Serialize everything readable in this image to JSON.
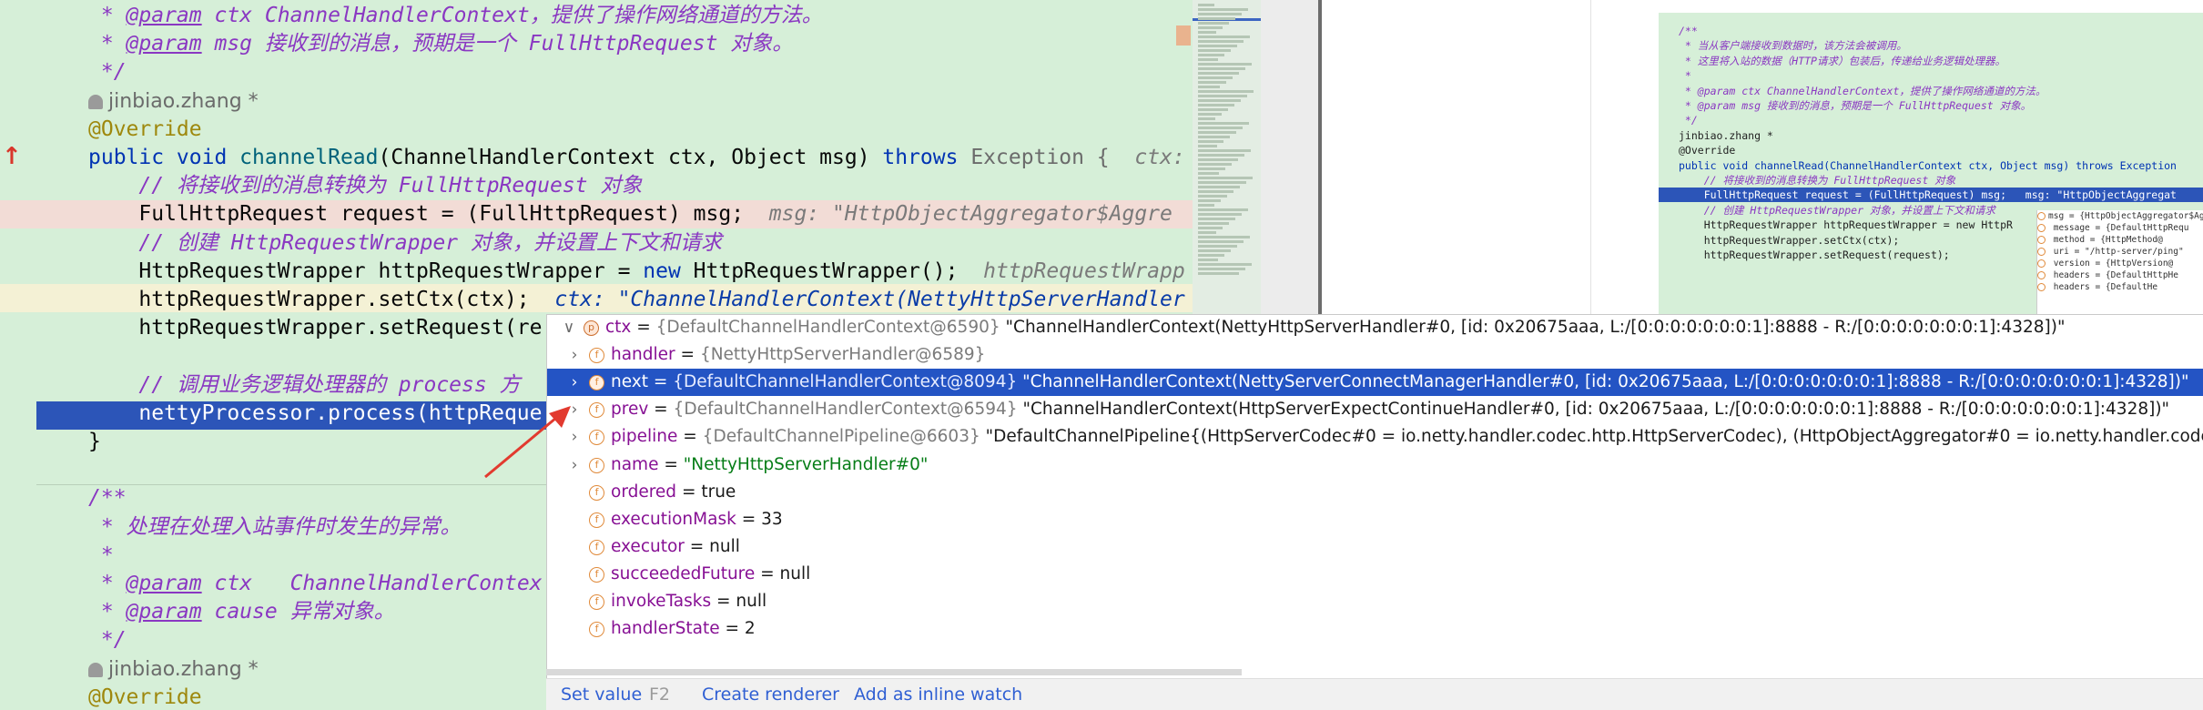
{
  "editor": {
    "lines": [
      {
        "segments": [
          {
            "t": " * ",
            "c": "c-cmt"
          },
          {
            "t": "@param",
            "c": "c-tag"
          },
          {
            "t": " ctx ",
            "c": "c-cmt"
          },
          {
            "t": "ChannelHandlerContext，提供了操作网络通道的方法。",
            "c": "c-cmt"
          }
        ]
      },
      {
        "segments": [
          {
            "t": " * ",
            "c": "c-cmt"
          },
          {
            "t": "@param",
            "c": "c-tag"
          },
          {
            "t": " msg 接收到的消息，预期是一个 FullHttpRequest 对象。",
            "c": "c-cmt"
          }
        ]
      },
      {
        "segments": [
          {
            "t": " */",
            "c": "c-cmt"
          }
        ]
      },
      {
        "author": "jinbiao.zhang *"
      },
      {
        "segments": [
          {
            "t": "@Override",
            "c": "c-ann"
          }
        ]
      },
      {
        "segments": [
          {
            "t": "public void ",
            "c": "c-kw"
          },
          {
            "t": "channelRead",
            "c": "c-fn"
          },
          {
            "t": "(ChannelHandlerContext ctx, Object msg) ",
            "c": ""
          },
          {
            "t": "throws ",
            "c": "c-kw"
          },
          {
            "t": "Exception {",
            "c": "c-grey"
          },
          {
            "t": "  ctx: ",
            "c": "c-inl"
          }
        ]
      },
      {
        "segments": [
          {
            "t": "    // 将接收到的消息转换为 FullHttpRequest 对象",
            "c": "c-cmt"
          }
        ]
      },
      {
        "segments": [
          {
            "t": "    FullHttpRequest request = (FullHttpRequest) msg;",
            "c": ""
          },
          {
            "t": "  msg: \"HttpObjectAggregator$Aggre",
            "c": "c-inl"
          }
        ]
      },
      {
        "segments": [
          {
            "t": "    // 创建 HttpRequestWrapper 对象，并设置上下文和请求",
            "c": "c-cmt"
          }
        ]
      },
      {
        "segments": [
          {
            "t": "    HttpRequestWrapper httpRequestWrapper = ",
            "c": ""
          },
          {
            "t": "new ",
            "c": "c-kw"
          },
          {
            "t": "HttpRequestWrapper();",
            "c": ""
          },
          {
            "t": "  httpRequestWrapp",
            "c": "c-inl"
          }
        ]
      },
      {
        "segments": [
          {
            "t": "    httpRequestWrapper.setCtx(ctx);",
            "c": ""
          },
          {
            "t": "  ctx: \"ChannelHandlerContext(NettyHttpServerHandler",
            "c": "c-inl-b"
          }
        ]
      },
      {
        "segments": [
          {
            "t": "    httpRequestWrapper.setRequest(re",
            "c": ""
          }
        ]
      },
      {
        "segments": [
          {
            "t": "",
            "c": ""
          }
        ]
      },
      {
        "segments": [
          {
            "t": "    // 调用业务逻辑处理器的 process 方",
            "c": "c-cmt"
          }
        ]
      },
      {
        "segments": [
          {
            "t": "    nettyProcessor.process(httpReque",
            "c": "c-white"
          }
        ]
      },
      {
        "segments": [
          {
            "t": "}",
            "c": ""
          }
        ]
      },
      {
        "segments": [
          {
            "t": "",
            "c": ""
          }
        ]
      },
      {
        "segments": [
          {
            "t": "/**",
            "c": "c-cmt"
          }
        ]
      },
      {
        "segments": [
          {
            "t": " * 处理在处理入站事件时发生的异常。",
            "c": "c-cmt"
          }
        ]
      },
      {
        "segments": [
          {
            "t": " *",
            "c": "c-cmt"
          }
        ]
      },
      {
        "segments": [
          {
            "t": " * ",
            "c": "c-cmt"
          },
          {
            "t": "@param",
            "c": "c-tag"
          },
          {
            "t": " ctx   ChannelHandlerContex",
            "c": "c-cmt"
          }
        ]
      },
      {
        "segments": [
          {
            "t": " * ",
            "c": "c-cmt"
          },
          {
            "t": "@param",
            "c": "c-tag"
          },
          {
            "t": " cause 异常对象。",
            "c": "c-cmt"
          }
        ]
      },
      {
        "segments": [
          {
            "t": " */",
            "c": "c-cmt"
          }
        ]
      },
      {
        "author": "jinbiao.zhang *"
      },
      {
        "segments": [
          {
            "t": "@Override",
            "c": "c-ann"
          }
        ]
      }
    ]
  },
  "thumbnail": {
    "lines": [
      {
        "t": "/**",
        "c": "doc"
      },
      {
        "t": " * 当从客户端接收到数据时，该方法会被调用。",
        "c": "doc"
      },
      {
        "t": " * 这里将入站的数据（HTTP请求）包装后，传递给业务逻辑处理器。",
        "c": "doc"
      },
      {
        "t": " *",
        "c": "doc"
      },
      {
        "t": " * @param ctx ChannelHandlerContext，提供了操作网络通道的方法。",
        "c": "doc"
      },
      {
        "t": " * @param msg 接收到的消息，预期是一个 FullHttpRequest 对象。",
        "c": "doc"
      },
      {
        "t": " */",
        "c": "doc"
      },
      {
        "t": "jinbiao.zhang *",
        "c": ""
      },
      {
        "t": "@Override",
        "c": ""
      },
      {
        "t": "public void channelRead(ChannelHandlerContext ctx, Object msg) throws Exception",
        "c": "kw"
      },
      {
        "t": "    // 将接收到的消息转换为 FullHttpRequest 对象",
        "c": "doc"
      },
      {
        "t": "    FullHttpRequest request = (FullHttpRequest) msg;   msg: \"HttpObjectAggregat",
        "c": "sel"
      },
      {
        "t": "    // 创建 HttpRequestWrapper 对象，并设置上下文和请求",
        "c": "doc"
      },
      {
        "t": "    HttpRequestWrapper httpRequestWrapper = new HttpR",
        "c": ""
      },
      {
        "t": "    httpRequestWrapper.setCtx(ctx);",
        "c": ""
      },
      {
        "t": "    httpRequestWrapper.setRequest(request);",
        "c": ""
      }
    ],
    "popup": [
      "msg = {HttpObjectAggregator$Ag",
      "  message = {DefaultHttpRequ",
      "    method = {HttpMethod@",
      "    uri = \"/http-server/ping\"",
      "    version = {HttpVersion@",
      "    headers = {DefaultHttpHe",
      "      headers = {DefaultHe"
    ]
  },
  "debug": {
    "rows": [
      {
        "chev": "v",
        "badge": "p",
        "name": "ctx",
        "type": "{DefaultChannelHandlerContext@6590}",
        "value": "\"ChannelHandlerContext(NettyHttpServerHandler#0, [id: 0x20675aaa, L:/[0:0:0:0:0:0:0:1]:8888 - R:/[0:0:0:0:0:0:0:1]:4328])\"",
        "level": 0
      },
      {
        "chev": ">",
        "badge": "f",
        "name": "handler",
        "type": "{NettyHttpServerHandler@6589}",
        "value": "",
        "level": 1
      },
      {
        "chev": ">",
        "badge": "f",
        "name": "next",
        "type": "{DefaultChannelHandlerContext@8094}",
        "value": "\"ChannelHandlerContext(NettyServerConnectManagerHandler#0, [id: 0x20675aaa, L:/[0:0:0:0:0:0:0:1]:8888 - R:/[0:0:0:0:0:0:0:1]:4328])\"",
        "level": 1,
        "selected": true
      },
      {
        "chev": ">",
        "badge": "f",
        "name": "prev",
        "type": "{DefaultChannelHandlerContext@6594}",
        "value": "\"ChannelHandlerContext(HttpServerExpectContinueHandler#0, [id: 0x20675aaa, L:/[0:0:0:0:0:0:0:1]:8888 - R:/[0:0:0:0:0:0:0:1]:4328])\"",
        "level": 1
      },
      {
        "chev": ">",
        "badge": "f",
        "name": "pipeline",
        "type": "{DefaultChannelPipeline@6603}",
        "value": "\"DefaultChannelPipeline{(HttpServerCodec#0 = io.netty.handler.codec.http.HttpServerCodec), (HttpObjectAggregator#0 = io.netty.handler.codec",
        "level": 1
      },
      {
        "chev": ">",
        "badge": "f",
        "name": "name",
        "type": "",
        "value": "\"NettyHttpServerHandler#0\"",
        "level": 1,
        "str": true
      },
      {
        "chev": "",
        "badge": "f",
        "name": "ordered",
        "type": "",
        "value": "true",
        "level": 1
      },
      {
        "chev": "",
        "badge": "f",
        "name": "executionMask",
        "type": "",
        "value": "33",
        "level": 1
      },
      {
        "chev": "",
        "badge": "f",
        "name": "executor",
        "type": "",
        "value": "null",
        "level": 1
      },
      {
        "chev": "",
        "badge": "f",
        "name": "succeededFuture",
        "type": "",
        "value": "null",
        "level": 1
      },
      {
        "chev": "",
        "badge": "f",
        "name": "invokeTasks",
        "type": "",
        "value": "null",
        "level": 1
      },
      {
        "chev": "",
        "badge": "f",
        "name": "handlerState",
        "type": "",
        "value": "2",
        "level": 1
      }
    ],
    "footer": {
      "set_value": "Set value",
      "set_value_key": "F2",
      "create_renderer": "Create renderer",
      "add_inline_watch": "Add as inline watch"
    }
  },
  "colors": {
    "editor_bg": "#d6efd8",
    "selection": "#2454c4",
    "arrow": "#e23a2f"
  }
}
